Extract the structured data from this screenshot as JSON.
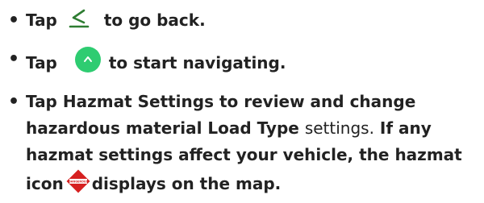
{
  "instructions": {
    "item1": {
      "before": "Tap",
      "icon": "back-chevron-icon",
      "after": "to go back."
    },
    "item2": {
      "before": "Tap",
      "icon": "start-navigation-icon",
      "after": "to start navigating."
    },
    "item3": {
      "part1": "Tap",
      "hazmat_settings": "Hazmat Settings",
      "part2": "to review and change hazardous material",
      "load_type": "Load Type",
      "settings_word": "settings.",
      "part3": "If any hazmat settings affect your vehicle, the hazmat icon",
      "hazmat_icon": "hazmat-dangerous-icon",
      "hazmat_icon_text": "DANGEROUS",
      "part4": "displays on the map."
    }
  },
  "colors": {
    "text": "#222222",
    "back_icon": "#2e7d32",
    "go_button": "#2ecc71",
    "hazmat_red": "#d62020"
  }
}
